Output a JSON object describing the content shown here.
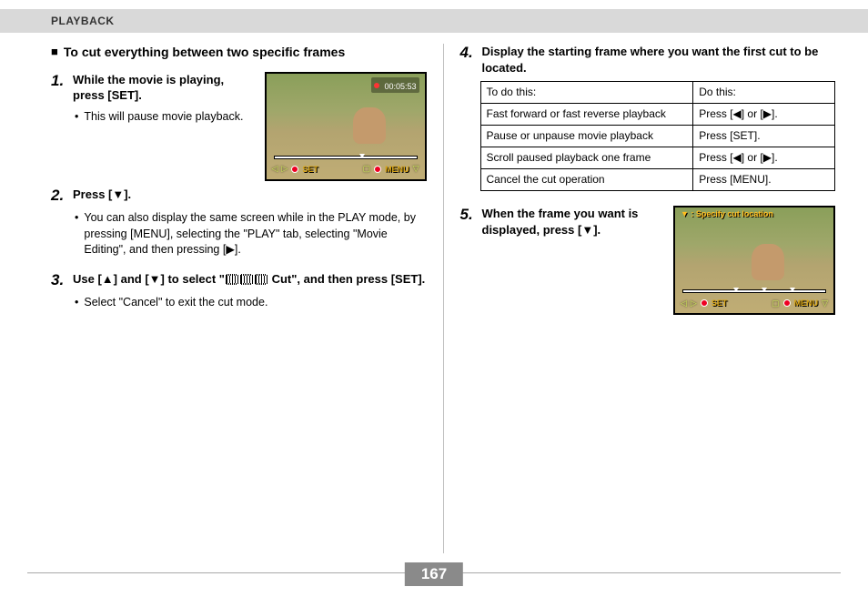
{
  "header": "PLAYBACK",
  "left": {
    "title": "To cut everything between two specific frames",
    "step1": {
      "num": "1.",
      "label": "While the movie is playing, press [SET].",
      "bullet": "This will pause movie playback."
    },
    "thumb1_timer": "00:05:53",
    "thumb1_set": "SET",
    "thumb1_menu": "MENU",
    "step2": {
      "num": "2.",
      "label": "Press [▼].",
      "bullet": "You can also display the same screen while in the PLAY mode, by pressing [MENU], selecting the \"PLAY\" tab, selecting \"Movie Editing\", and then pressing [▶]."
    },
    "step3": {
      "num": "3.",
      "label_before": "Use [▲] and [▼] to select \"",
      "label_after": " Cut\", and then press [SET].",
      "bullet": "Select \"Cancel\" to exit the cut mode."
    }
  },
  "right": {
    "step4": {
      "num": "4.",
      "label": "Display the starting frame where you want the first cut to be located."
    },
    "table": {
      "h1": "To do this:",
      "h2": "Do this:",
      "rows": [
        {
          "a": "Fast forward or fast reverse playback",
          "b": "Press [◀] or [▶]."
        },
        {
          "a": "Pause or unpause movie playback",
          "b": "Press [SET]."
        },
        {
          "a": "Scroll paused playback one frame",
          "b": "Press [◀] or [▶]."
        },
        {
          "a": "Cancel the cut operation",
          "b": "Press [MENU]."
        }
      ]
    },
    "step5": {
      "num": "5.",
      "label": "When the frame you want is displayed, press [▼]."
    },
    "thumb2_label": "▼ : Specify cut location",
    "thumb2_set": "SET",
    "thumb2_menu": "MENU"
  },
  "page": "167"
}
